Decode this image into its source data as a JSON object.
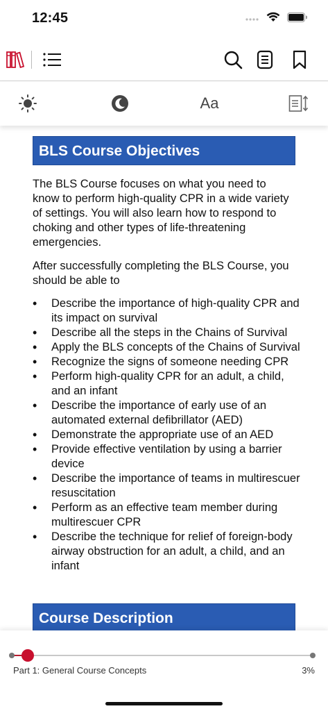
{
  "status_bar": {
    "time": "12:45"
  },
  "settings": {
    "font_label": "Aa"
  },
  "content": {
    "heading1": "BLS Course Objectives",
    "intro": "The BLS Course focuses on what you need to know to perform high-quality CPR in a wide variety of settings. You will also learn how to respond to choking and other types of life-threatening emergencies.",
    "lead_in": "After successfully completing the BLS Course, you should be able to",
    "objectives": [
      "Describe the importance of high-quality CPR and its impact on survival",
      "Describe all the steps in the Chains of Survival",
      "Apply the BLS concepts of the Chains of Survival",
      "Recognize the signs of someone needing CPR",
      "Perform high-quality CPR for an adult, a child, and an infant",
      "Describe the importance of early use of an automated external defibrillator (AED)",
      "Demonstrate the appropriate use of an AED",
      "Provide effective ventilation by using a barrier device",
      "Describe the importance of teams in multirescuer resuscitation",
      "Perform as an effective team member during multirescuer CPR",
      "Describe the technique for relief of foreign-body airway obstruction for an adult, a child, and an infant"
    ],
    "heading2": "Course Description"
  },
  "footer": {
    "chapter": "Part 1: General Course Concepts",
    "percent_label": "3%",
    "progress": 0.055
  },
  "colors": {
    "heading_bg": "#2a5cb3",
    "accent_red": "#c8102e"
  }
}
